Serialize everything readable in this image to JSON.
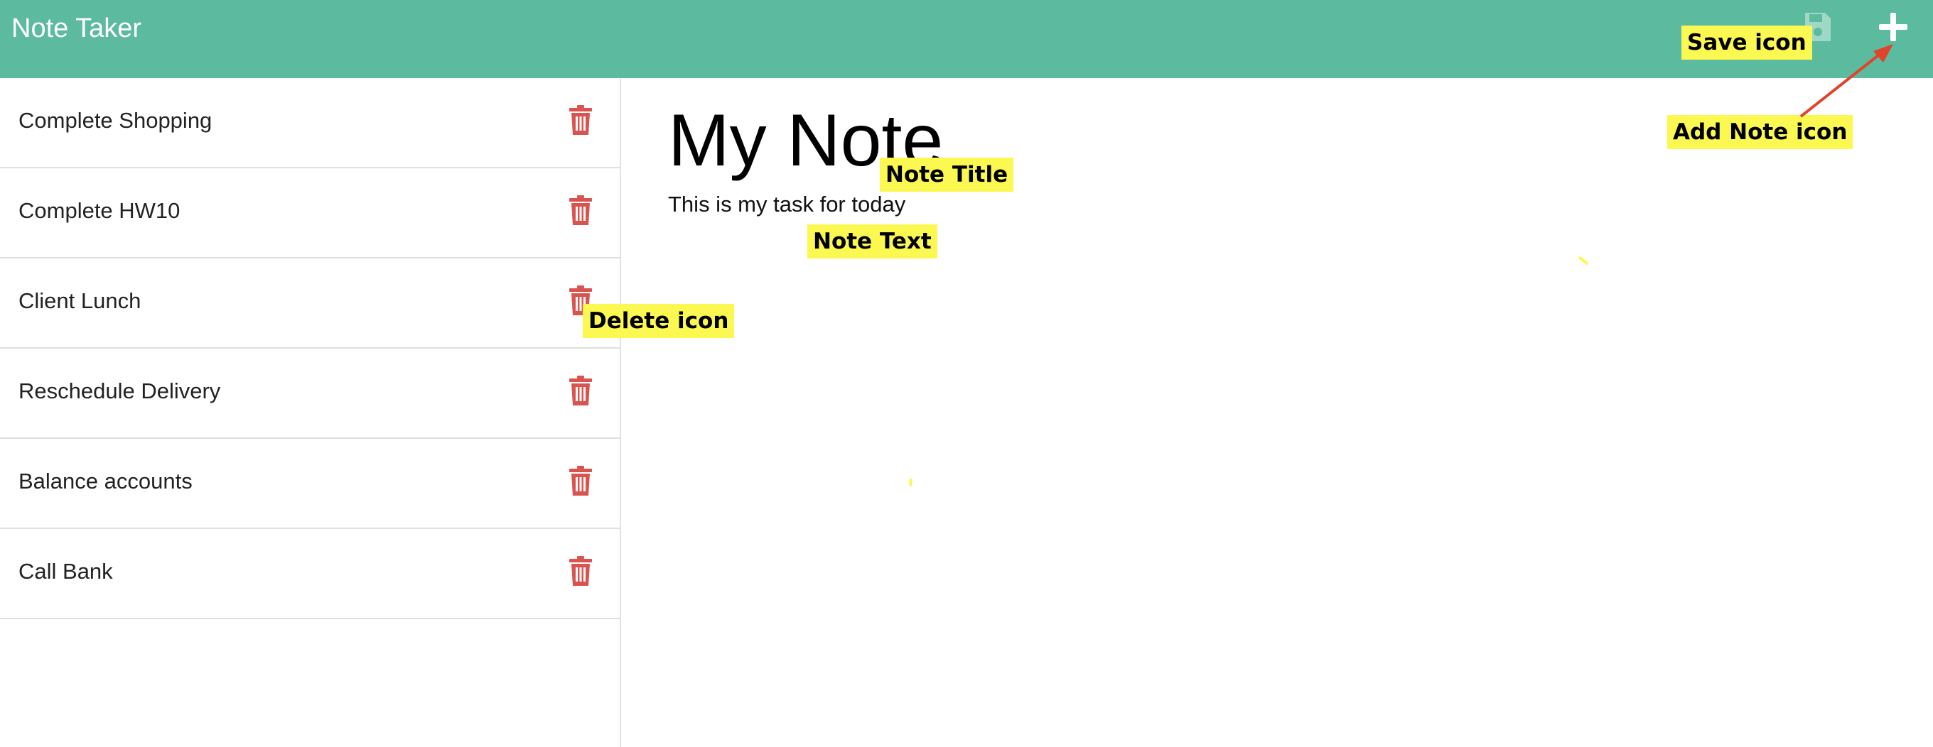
{
  "app": {
    "title": "Note Taker"
  },
  "toolbar": {
    "save_icon": "save-icon",
    "add_icon": "plus-icon"
  },
  "notes": [
    {
      "title": "Complete Shopping"
    },
    {
      "title": "Complete HW10"
    },
    {
      "title": "Client Lunch"
    },
    {
      "title": "Reschedule Delivery"
    },
    {
      "title": "Balance accounts"
    },
    {
      "title": "Call Bank"
    }
  ],
  "active_note": {
    "title": "My Note",
    "text": "This is my task for today"
  },
  "annotations": {
    "save": "Save icon",
    "add": "Add Note icon",
    "title": "Note Title",
    "text": "Note Text",
    "delete": "Delete icon"
  },
  "colors": {
    "navbar": "#5cba9e",
    "delete_icon": "#d9534f",
    "annotation_bg": "#fbf851",
    "arrow": "#e0442a"
  }
}
